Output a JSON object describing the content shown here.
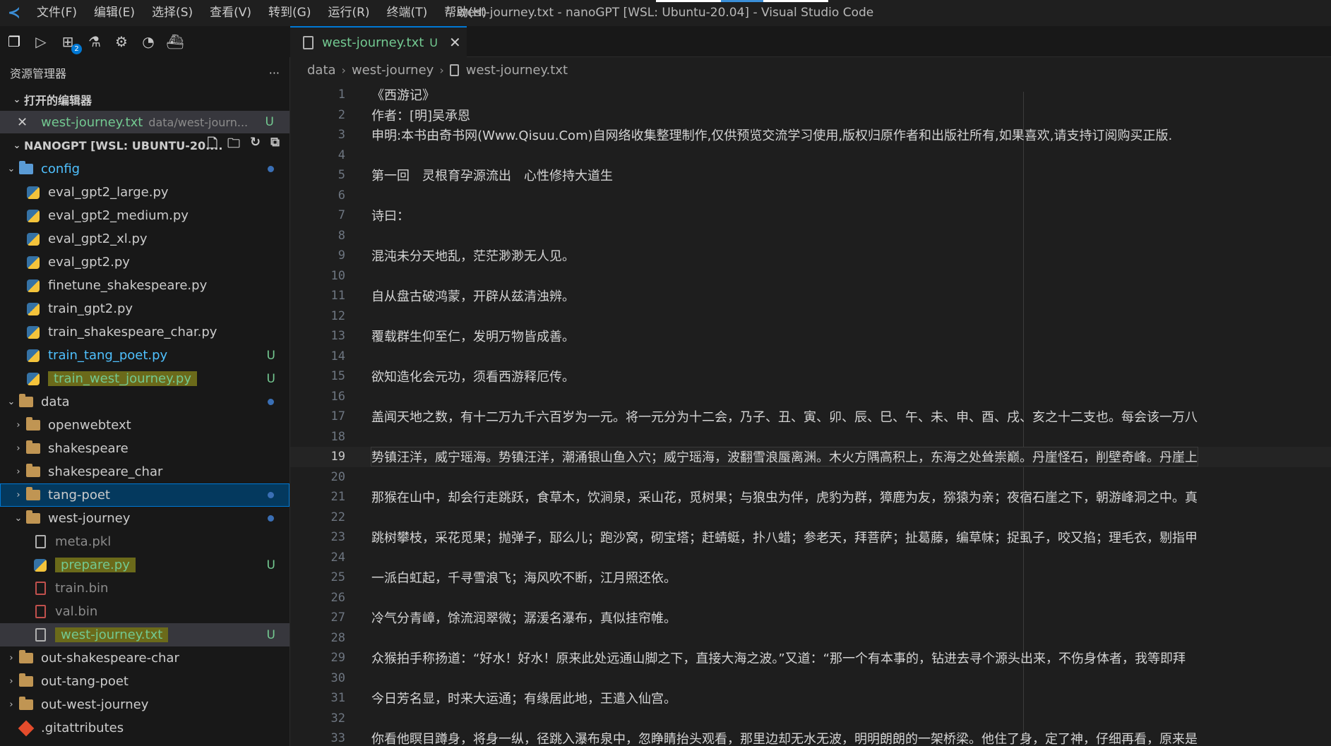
{
  "menu": [
    "文件(F)",
    "编辑(E)",
    "选择(S)",
    "查看(V)",
    "转到(G)",
    "运行(R)",
    "终端(T)",
    "帮助(H)"
  ],
  "window_title": "west-journey.txt - nanoGPT [WSL: Ubuntu-20.04] - Visual Studio Code",
  "activity_badge": "2",
  "sidebar": {
    "title": "资源管理器",
    "more": "···",
    "open_editors_label": "打开的编辑器",
    "open_editor": {
      "name": "west-journey.txt",
      "path": "data/west-journ...",
      "status": "U"
    },
    "root_label": "NANOGPT [WSL: UBUNTU-20....",
    "tree": [
      {
        "label": "config",
        "type": "folder-config",
        "depth": 0,
        "expanded": true,
        "color": "blue",
        "badge": "dot"
      },
      {
        "label": "eval_gpt2_large.py",
        "type": "py",
        "depth": 1
      },
      {
        "label": "eval_gpt2_medium.py",
        "type": "py",
        "depth": 1
      },
      {
        "label": "eval_gpt2_xl.py",
        "type": "py",
        "depth": 1
      },
      {
        "label": "eval_gpt2.py",
        "type": "py",
        "depth": 1
      },
      {
        "label": "finetune_shakespeare.py",
        "type": "py",
        "depth": 1
      },
      {
        "label": "train_gpt2.py",
        "type": "py",
        "depth": 1
      },
      {
        "label": "train_shakespeare_char.py",
        "type": "py",
        "depth": 1
      },
      {
        "label": "train_tang_poet.py",
        "type": "py",
        "depth": 1,
        "color": "blue",
        "badge": "U"
      },
      {
        "label": "train_west_journey.py",
        "type": "py",
        "depth": 1,
        "color": "green",
        "badge": "U",
        "highlight": true
      },
      {
        "label": "data",
        "type": "folder",
        "depth": 0,
        "expanded": true,
        "badge": "dot"
      },
      {
        "label": "openwebtext",
        "type": "folder",
        "depth": 1,
        "expanded": false
      },
      {
        "label": "shakespeare",
        "type": "folder",
        "depth": 1,
        "expanded": false
      },
      {
        "label": "shakespeare_char",
        "type": "folder",
        "depth": 1,
        "expanded": false
      },
      {
        "label": "tang-poet",
        "type": "folder",
        "depth": 1,
        "expanded": false,
        "selected": true,
        "badge": "dot"
      },
      {
        "label": "west-journey",
        "type": "folder",
        "depth": 1,
        "expanded": true,
        "badge": "dot"
      },
      {
        "label": "meta.pkl",
        "type": "doc",
        "depth": 2,
        "color": "dim"
      },
      {
        "label": "prepare.py",
        "type": "py",
        "depth": 2,
        "color": "green",
        "badge": "U",
        "highlight": true
      },
      {
        "label": "train.bin",
        "type": "bin",
        "depth": 2,
        "color": "dim"
      },
      {
        "label": "val.bin",
        "type": "bin",
        "depth": 2,
        "color": "dim"
      },
      {
        "label": "west-journey.txt",
        "type": "doc",
        "depth": 2,
        "color": "green",
        "badge": "U",
        "highlight": true,
        "open": true
      },
      {
        "label": "out-shakespeare-char",
        "type": "folder",
        "depth": 0,
        "expanded": false
      },
      {
        "label": "out-tang-poet",
        "type": "folder",
        "depth": 0,
        "expanded": false
      },
      {
        "label": "out-west-journey",
        "type": "folder",
        "depth": 0,
        "expanded": false
      },
      {
        "label": ".gitattributes",
        "type": "git",
        "depth": 0
      }
    ]
  },
  "tab": {
    "label": "west-journey.txt",
    "status": "U",
    "close": "✕"
  },
  "breadcrumb": [
    "data",
    "west-journey",
    "west-journey.txt"
  ],
  "current_line": 19,
  "lines": [
    "《西游记》",
    "作者：[明]吴承恩",
    "申明:本书由奇书网(Www.Qisuu.Com)自网络收集整理制作,仅供预览交流学习使用,版权归原作者和出版社所有,如果喜欢,请支持订阅购买正版.",
    "",
    "第一回　灵根育孕源流出　心性修持大道生",
    "",
    "诗曰：",
    "",
    "混沌未分天地乱，茫茫渺渺无人见。",
    "",
    "自从盘古破鸿蒙，开辟从兹清浊辨。",
    "",
    "覆载群生仰至仁，发明万物皆成善。",
    "",
    "欲知造化会元功，须看西游释厄传。",
    "",
    "盖闻天地之数，有十二万九千六百岁为一元。将一元分为十二会，乃子、丑、寅、卯、辰、巳、午、未、申、酉、戌、亥之十二支也。每会该一万八",
    "",
    "势镇汪洋，威宁瑶海。势镇汪洋，潮涌银山鱼入穴；威宁瑶海，波翻雪浪蜃离渊。木火方隅高积上，东海之处耸崇巅。丹崖怪石，削壁奇峰。丹崖上",
    "",
    "那猴在山中，却会行走跳跃，食草木，饮涧泉，采山花，觅树果；与狼虫为伴，虎豹为群，獐鹿为友，猕猿为亲；夜宿石崖之下，朝游峰洞之中。真",
    "",
    "跳树攀枝，采花觅果；抛弹子，邷么儿；跑沙窝，砌宝塔；赶蜻蜓，扑八蜡；参老天，拜菩萨；扯葛藤，编草帓；捉虱子，咬又掐；理毛衣，剔指甲",
    "",
    "一派白虹起，千寻雪浪飞；海风吹不断，江月照还依。",
    "",
    "冷气分青嶂，馀流润翠微；潺湲名瀑布，真似挂帘帷。",
    "",
    "众猴拍手称扬道：“好水！好水！原来此处远通山脚之下，直接大海之波。”又道：“那一个有本事的，钻进去寻个源头出来，不伤身体者，我等即拜",
    "",
    "今日芳名显，时来大运通；有缘居此地，王遣入仙宫。",
    "",
    "你看他瞑目蹲身，将身一纵，径跳入瀑布泉中，忽睁睛抬头观看，那里边却无水无波，明明朗朗的一架桥梁。他住了身，定了神，仔细再看，原来是"
  ]
}
